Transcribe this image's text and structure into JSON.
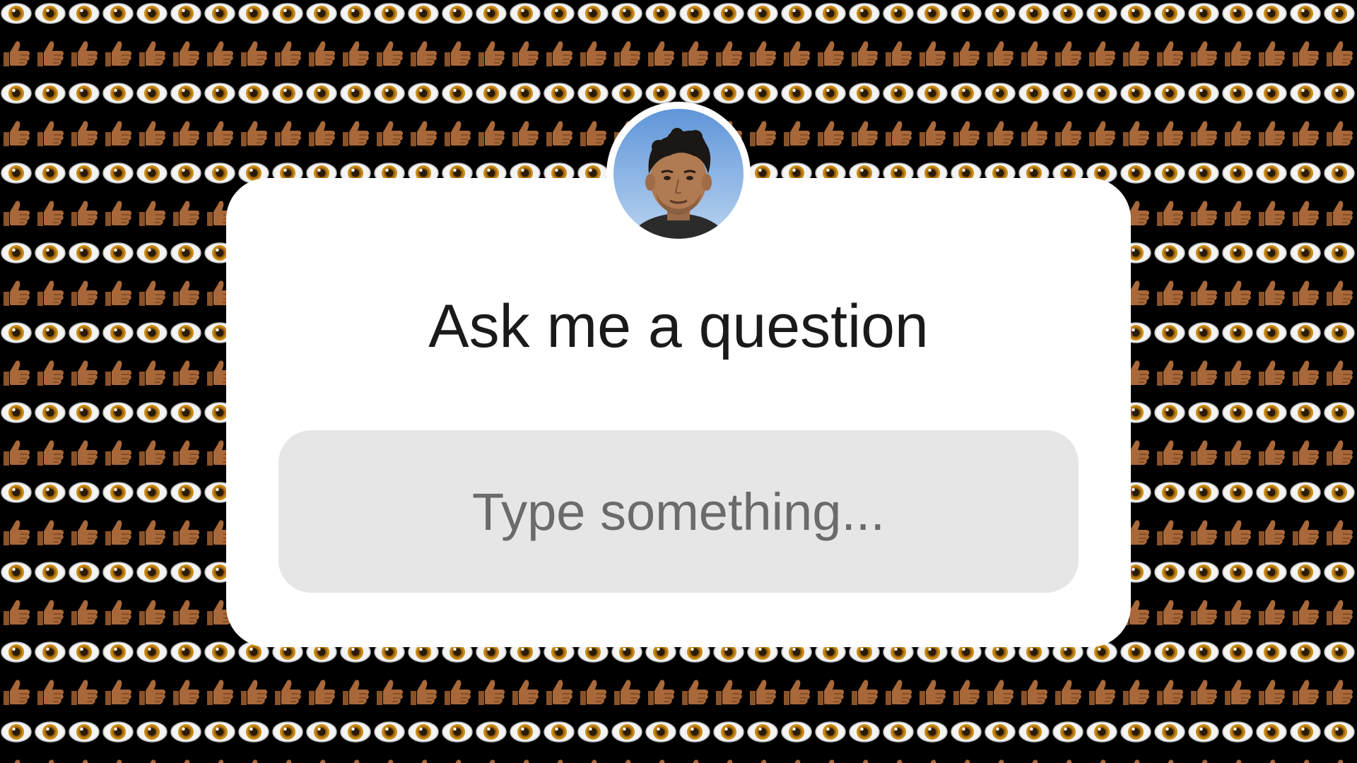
{
  "background": {
    "color": "#000000",
    "pattern_icons": [
      "eye-icon",
      "thumbs-up-icon"
    ],
    "eye_iris_color": "#c98a14",
    "thumb_color": "#a8683a"
  },
  "question_sticker": {
    "title": "Ask me a question",
    "input_placeholder": "Type something...",
    "card_color": "#ffffff",
    "input_color": "#e6e6e6",
    "avatar": "profile-photo"
  }
}
